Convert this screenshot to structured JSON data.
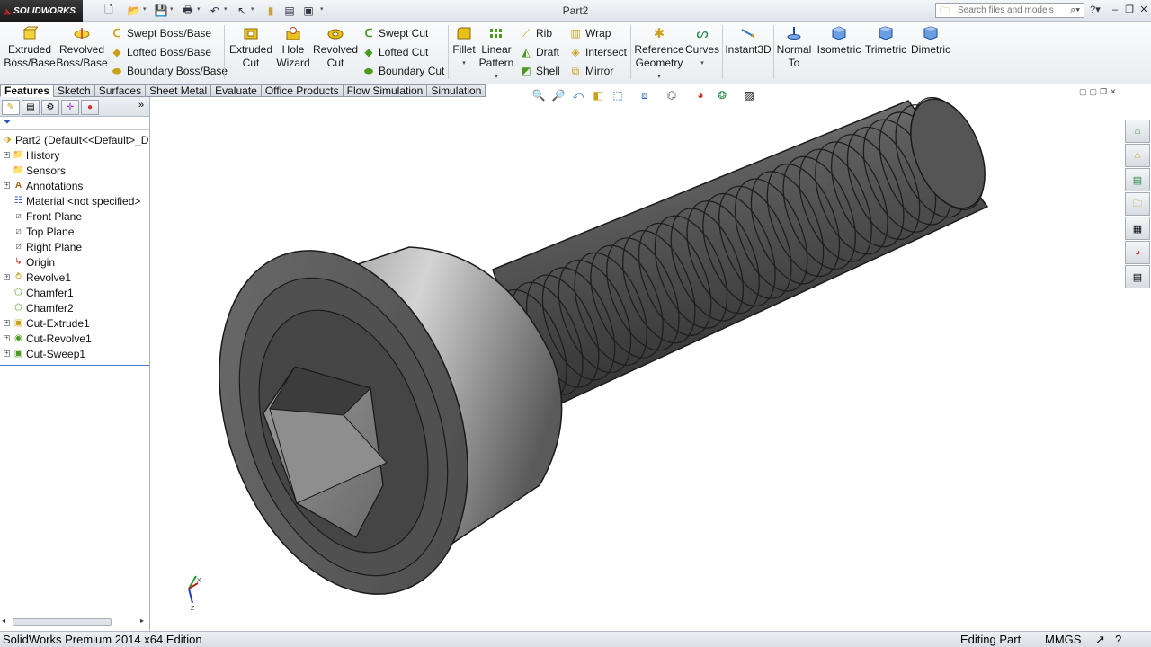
{
  "app": {
    "brand": "SOLIDWORKS",
    "document_title": "Part2"
  },
  "search": {
    "placeholder": "Search files and models"
  },
  "ribbon": {
    "extruded_boss": "Extruded\nBoss/Base",
    "revolved_boss": "Revolved\nBoss/Base",
    "swept_boss": "Swept Boss/Base",
    "lofted_boss": "Lofted Boss/Base",
    "boundary_boss": "Boundary Boss/Base",
    "extruded_cut": "Extruded\nCut",
    "hole_wizard": "Hole\nWizard",
    "revolved_cut": "Revolved\nCut",
    "swept_cut": "Swept Cut",
    "lofted_cut": "Lofted Cut",
    "boundary_cut": "Boundary Cut",
    "fillet": "Fillet",
    "linear_pattern": "Linear\nPattern",
    "rib": "Rib",
    "draft": "Draft",
    "shell": "Shell",
    "wrap": "Wrap",
    "intersect": "Intersect",
    "mirror": "Mirror",
    "reference_geometry": "Reference\nGeometry",
    "curves": "Curves",
    "instant3d": "Instant3D",
    "normal_to": "Normal\nTo",
    "isometric": "Isometric",
    "trimetric": "Trimetric",
    "dimetric": "Dimetric"
  },
  "tabs": [
    "Features",
    "Sketch",
    "Surfaces",
    "Sheet Metal",
    "Evaluate",
    "Office Products",
    "Flow Simulation",
    "Simulation"
  ],
  "tree": {
    "root": "Part2  (Default<<Default>_D",
    "items": [
      "History",
      "Sensors",
      "Annotations",
      "Material <not specified>",
      "Front Plane",
      "Top Plane",
      "Right Plane",
      "Origin",
      "Revolve1",
      "Chamfer1",
      "Chamfer2",
      "Cut-Extrude1",
      "Cut-Revolve1",
      "Cut-Sweep1"
    ]
  },
  "status": {
    "edition": "SolidWorks Premium 2014 x64 Edition",
    "mode": "Editing Part",
    "units": "MMGS"
  },
  "colors": {
    "accent_red": "#d8232a",
    "feature_yellow": "#e8c21a",
    "model_gray": "#6a6a6a"
  }
}
